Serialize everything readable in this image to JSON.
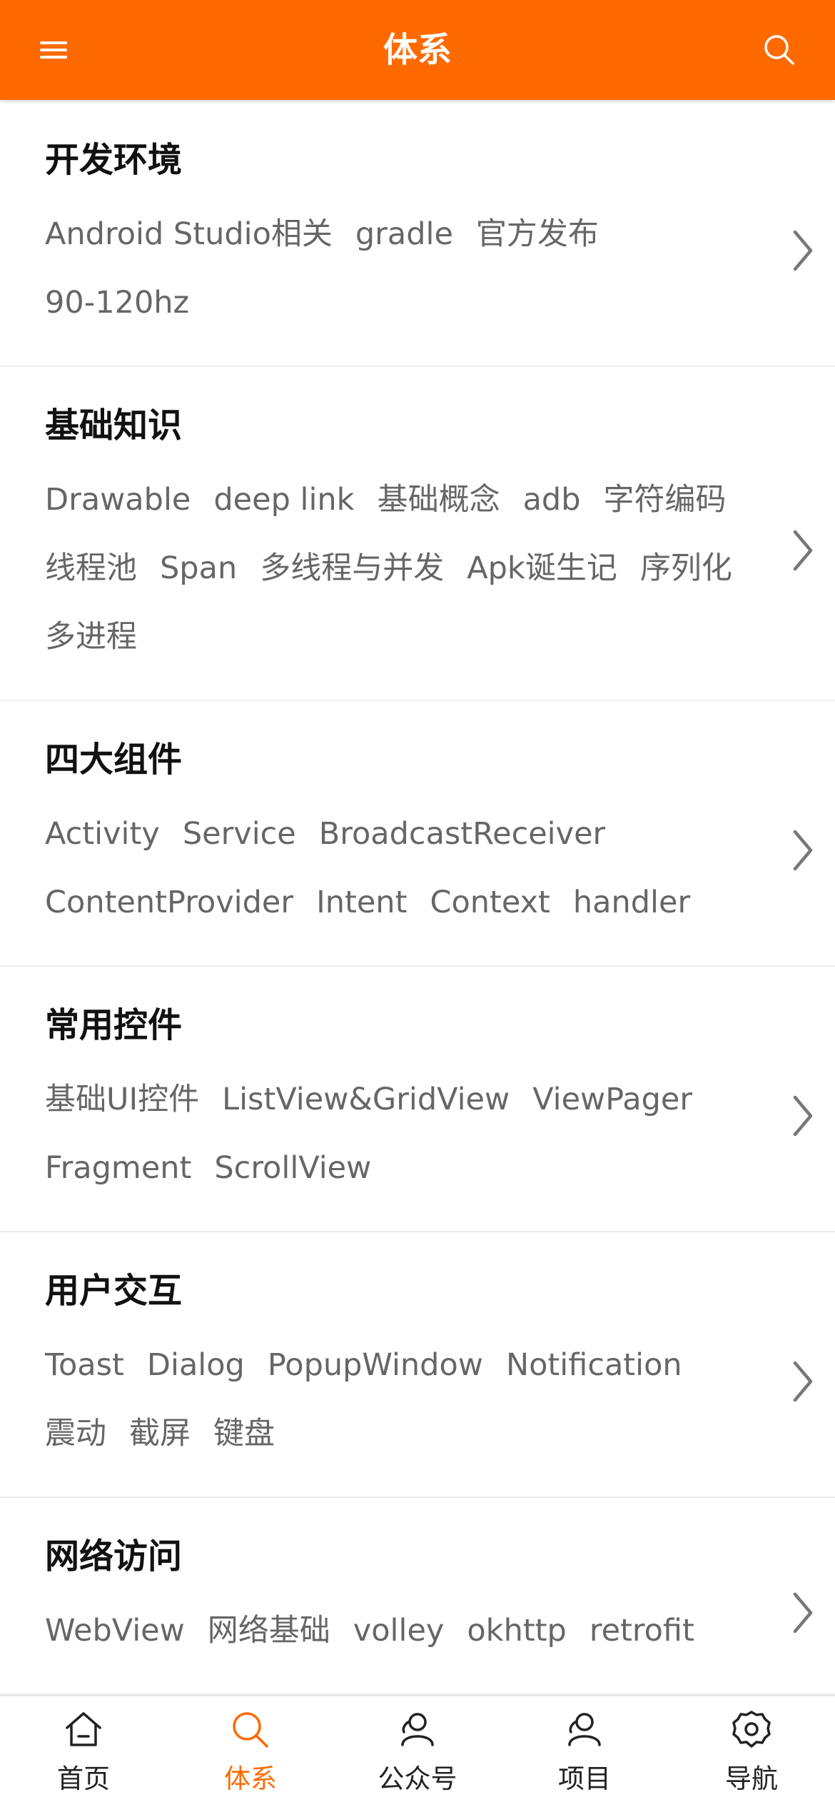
{
  "header": {
    "title": "体系",
    "menu_icon": "menu-icon",
    "search_icon": "search-icon",
    "bg_color": "#ff6a00"
  },
  "categories": [
    {
      "title": "开发环境",
      "tags": [
        "Android Studio相关",
        "gradle",
        "官方发布",
        "90-120hz"
      ]
    },
    {
      "title": "基础知识",
      "tags": [
        "Drawable",
        "deep link",
        "基础概念",
        "adb",
        "字符编码",
        "线程池",
        "Span",
        "多线程与并发",
        "Apk诞生记",
        "序列化",
        "多进程"
      ]
    },
    {
      "title": "四大组件",
      "tags": [
        "Activity",
        "Service",
        "BroadcastReceiver",
        "ContentProvider",
        "Intent",
        "Context",
        "handler"
      ]
    },
    {
      "title": "常用控件",
      "tags": [
        "基础UI控件",
        "ListView&GridView",
        "ViewPager",
        "Fragment",
        "ScrollView"
      ]
    },
    {
      "title": "用户交互",
      "tags": [
        "Toast",
        "Dialog",
        "PopupWindow",
        "Notification",
        "震动",
        "截屏",
        "键盘"
      ]
    },
    {
      "title": "网络访问",
      "tags": [
        "WebView",
        "网络基础",
        "volley",
        "okhttp",
        "retrofit"
      ]
    }
  ],
  "bottom_nav": {
    "active_index": 1,
    "active_color": "#ff6a00",
    "items": [
      {
        "label": "首页",
        "icon": "home-icon"
      },
      {
        "label": "体系",
        "icon": "search-icon"
      },
      {
        "label": "公众号",
        "icon": "user-icon"
      },
      {
        "label": "项目",
        "icon": "user-icon"
      },
      {
        "label": "导航",
        "icon": "gear-icon"
      }
    ]
  }
}
